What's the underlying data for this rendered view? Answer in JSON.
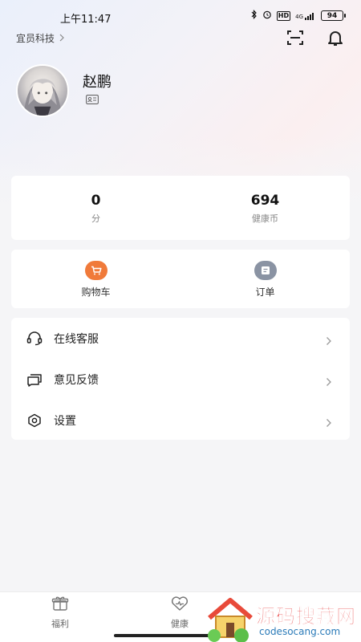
{
  "status_bar": {
    "time": "上午11:47",
    "network": "4G",
    "battery": "94"
  },
  "header": {
    "company": "宜员科技",
    "scan_icon": "scan-icon",
    "bell_icon": "bell-icon"
  },
  "profile": {
    "name": "赵鹏",
    "id_icon": "id-card-icon"
  },
  "stats": [
    {
      "value": "0",
      "label": "分"
    },
    {
      "value": "694",
      "label": "健康币"
    }
  ],
  "orders": [
    {
      "label": "购物车",
      "icon": "cart-icon",
      "color": "#f07a3a"
    },
    {
      "label": "订单",
      "icon": "order-icon",
      "color": "#8a93a3"
    }
  ],
  "menu": [
    {
      "label": "在线客服",
      "icon": "headset-icon"
    },
    {
      "label": "意见反馈",
      "icon": "feedback-icon"
    },
    {
      "label": "设置",
      "icon": "settings-icon"
    }
  ],
  "bottom_nav": [
    {
      "label": "福利",
      "icon": "gift-icon"
    },
    {
      "label": "健康",
      "icon": "heart-icon"
    }
  ],
  "watermark": {
    "title": "源码搜藏网",
    "subtitle": "codesocang.com"
  }
}
